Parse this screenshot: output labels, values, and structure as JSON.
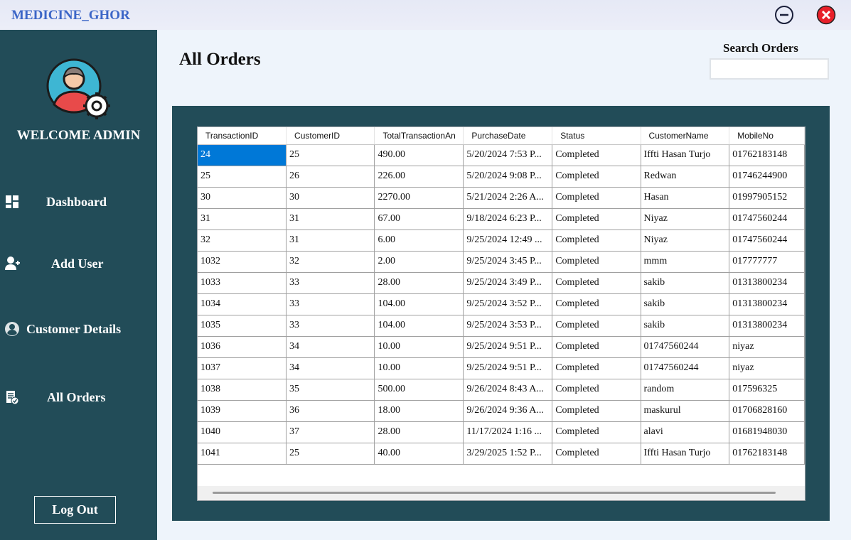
{
  "app": {
    "title": "MEDICINE_GHOR"
  },
  "window_controls": {
    "minimize_icon": "minus-circle-icon",
    "close_icon": "x-circle-icon",
    "close_color": "#e8202a"
  },
  "sidebar": {
    "welcome": "WELCOME ADMIN",
    "items": [
      {
        "label": "Dashboard",
        "icon": "dashboard-icon"
      },
      {
        "label": "Add User",
        "icon": "add-user-icon"
      },
      {
        "label": "Customer Details",
        "icon": "customer-icon"
      },
      {
        "label": "All Orders",
        "icon": "orders-icon"
      }
    ],
    "logout": "Log Out",
    "bg_color": "#224c58"
  },
  "main": {
    "title": "All Orders",
    "search": {
      "label": "Search Orders",
      "value": "",
      "placeholder": ""
    }
  },
  "table": {
    "columns": [
      "TransactionID",
      "CustomerID",
      "TotalTransactionAn",
      "PurchaseDate",
      "Status",
      "CustomerName",
      "MobileNo"
    ],
    "rows": [
      [
        "24",
        "25",
        "490.00",
        "5/20/2024 7:53 P...",
        "Completed",
        "Iffti Hasan Turjo",
        "01762183148"
      ],
      [
        "25",
        "26",
        "226.00",
        "5/20/2024 9:08 P...",
        "Completed",
        "Redwan",
        "01746244900"
      ],
      [
        "30",
        "30",
        "2270.00",
        "5/21/2024 2:26 A...",
        "Completed",
        "Hasan",
        "01997905152"
      ],
      [
        "31",
        "31",
        "67.00",
        "9/18/2024 6:23 P...",
        "Completed",
        "Niyaz",
        "01747560244"
      ],
      [
        "32",
        "31",
        "6.00",
        "9/25/2024 12:49 ...",
        "Completed",
        "Niyaz",
        "01747560244"
      ],
      [
        "1032",
        "32",
        "2.00",
        "9/25/2024 3:45 P...",
        "Completed",
        "mmm",
        "017777777"
      ],
      [
        "1033",
        "33",
        "28.00",
        "9/25/2024 3:49 P...",
        "Completed",
        "sakib",
        "01313800234"
      ],
      [
        "1034",
        "33",
        "104.00",
        "9/25/2024 3:52 P...",
        "Completed",
        "sakib",
        "01313800234"
      ],
      [
        "1035",
        "33",
        "104.00",
        "9/25/2024 3:53 P...",
        "Completed",
        "sakib",
        "01313800234"
      ],
      [
        "1036",
        "34",
        "10.00",
        "9/25/2024 9:51 P...",
        "Completed",
        "01747560244",
        "niyaz"
      ],
      [
        "1037",
        "34",
        "10.00",
        "9/25/2024 9:51 P...",
        "Completed",
        "01747560244",
        "niyaz"
      ],
      [
        "1038",
        "35",
        "500.00",
        "9/26/2024 8:43 A...",
        "Completed",
        "random",
        "017596325"
      ],
      [
        "1039",
        "36",
        "18.00",
        "9/26/2024 9:36 A...",
        "Completed",
        "maskurul",
        "01706828160"
      ],
      [
        "1040",
        "37",
        "28.00",
        "11/17/2024 1:16 ...",
        "Completed",
        "alavi",
        "01681948030"
      ],
      [
        "1041",
        "25",
        "40.00",
        "3/29/2025 1:52 P...",
        "Completed",
        "Iffti Hasan Turjo",
        "01762183148"
      ]
    ]
  }
}
